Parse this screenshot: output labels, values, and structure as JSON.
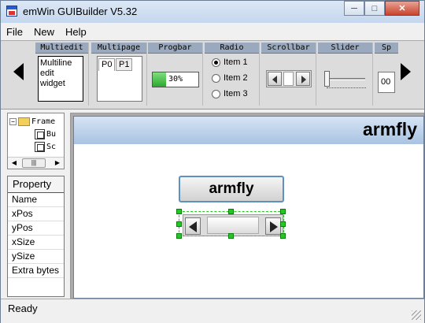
{
  "window": {
    "title": "emWin GUIBuilder V5.32",
    "controls": [
      "minimize",
      "maximize",
      "close"
    ]
  },
  "menu": [
    "File",
    "New",
    "Help"
  ],
  "toolbar": {
    "palette": [
      {
        "caption": "Multiedit",
        "text": "Multiline edit widget"
      },
      {
        "caption": "Multipage",
        "tabs": [
          "P0",
          "P1"
        ]
      },
      {
        "caption": "Progbar",
        "label": "30%",
        "value": 0.3
      },
      {
        "caption": "Radio",
        "items": [
          "Item 1",
          "Item 2",
          "Item 3"
        ],
        "selected": 0
      },
      {
        "caption": "Scrollbar"
      },
      {
        "caption": "Slider"
      },
      {
        "caption": "Sp",
        "value": "00"
      }
    ]
  },
  "tree": {
    "nodes": [
      {
        "label": "Frame",
        "icon": "folder-icon"
      },
      {
        "label": "Bu",
        "icon": "button-icon"
      },
      {
        "label": "Sc",
        "icon": "scrollbar-icon"
      }
    ]
  },
  "properties": {
    "header": "Property",
    "rows": [
      "Name",
      "xPos",
      "yPos",
      "xSize",
      "ySize",
      "Extra bytes"
    ]
  },
  "canvas": {
    "frame_title": "armfly",
    "button_text": "armfly"
  },
  "status": "Ready",
  "colors": {
    "title_bar": "#c5d7ee",
    "selection": "#22c922",
    "progress": "#2da82d"
  }
}
